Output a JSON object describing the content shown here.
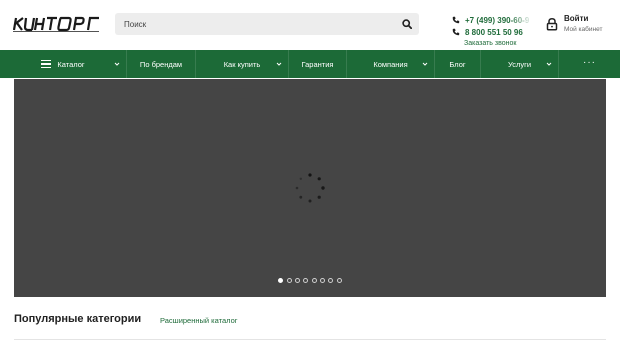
{
  "header": {
    "logo_text": "КУНТОРГ",
    "search": {
      "placeholder": "Поиск"
    },
    "phones": [
      "+7 (499) 390-60-9",
      "8 800 551 50 96"
    ],
    "callback_label": "Заказать звонок",
    "account": {
      "login_label": "Войти",
      "cabinet_label": "Мой кабинет"
    }
  },
  "nav": {
    "items": [
      {
        "label": "Каталог",
        "has_dropdown": true,
        "icon": "hamburger-icon"
      },
      {
        "label": "По брендам",
        "has_dropdown": false
      },
      {
        "label": "Как купить",
        "has_dropdown": true
      },
      {
        "label": "Гарантия",
        "has_dropdown": false
      },
      {
        "label": "Компания",
        "has_dropdown": true
      },
      {
        "label": "Блог",
        "has_dropdown": false
      },
      {
        "label": "Услуги",
        "has_dropdown": true
      },
      {
        "label": "···",
        "has_dropdown": false
      }
    ]
  },
  "slider": {
    "slide_count": 8,
    "active_index": 0,
    "state": "loading"
  },
  "popular": {
    "title": "Популярные категории",
    "extended_link": "Расширенный каталог"
  },
  "colors": {
    "brand_green": "#1c6a37",
    "slider_bg": "#454545",
    "link_green": "#1f6b3a"
  }
}
